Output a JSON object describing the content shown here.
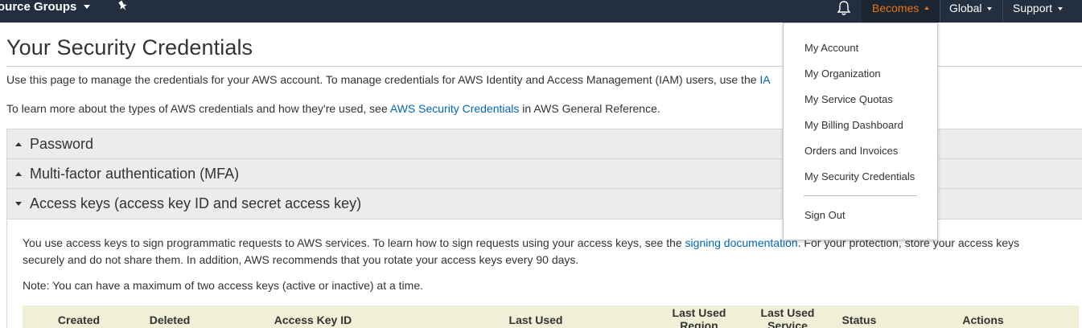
{
  "nav": {
    "resource_groups": "ource Groups",
    "account_menu": "Becomes",
    "region": "Global",
    "support": "Support"
  },
  "icons": {
    "pin": "pin-icon",
    "bell": "bell-icon"
  },
  "colors": {
    "nav_bg": "#232f3e",
    "accent": "#ec7211",
    "link": "#0066bb",
    "table_header_bg": "#f0f0d6"
  },
  "page": {
    "title": "Your Security Credentials",
    "intro_text": "Use this page to manage the credentials for your AWS account. To manage credentials for AWS Identity and Access Management (IAM) users, use the ",
    "intro_link": "IA",
    "learn_prefix": "To learn more about the types of AWS credentials and how they're used, see ",
    "learn_link": "AWS Security Credentials",
    "learn_suffix": " in AWS General Reference."
  },
  "sections": [
    {
      "label": "Password"
    },
    {
      "label": "Multi-factor authentication (MFA)"
    },
    {
      "label": "Access keys (access key ID and secret access key)"
    }
  ],
  "access_keys": {
    "desc_prefix": "You use access keys to sign programmatic requests to AWS services. To learn how to sign requests using your access keys, see the ",
    "desc_link": "signing documentation",
    "desc_suffix": ". For your protection, store your access keys",
    "desc_line2": "securely and do not share them. In addition, AWS recommends that you rotate your access keys every 90 days.",
    "note": "Note: You can have a maximum of two access keys (active or inactive) at a time.",
    "columns": [
      "Created",
      "Deleted",
      "Access Key ID",
      "Last Used",
      "Last Used Region",
      "Last Used Service",
      "Status",
      "Actions"
    ]
  },
  "menu": {
    "items": [
      "My Account",
      "My Organization",
      "My Service Quotas",
      "My Billing Dashboard",
      "Orders and Invoices",
      "My Security Credentials"
    ],
    "sign_out": "Sign Out"
  }
}
